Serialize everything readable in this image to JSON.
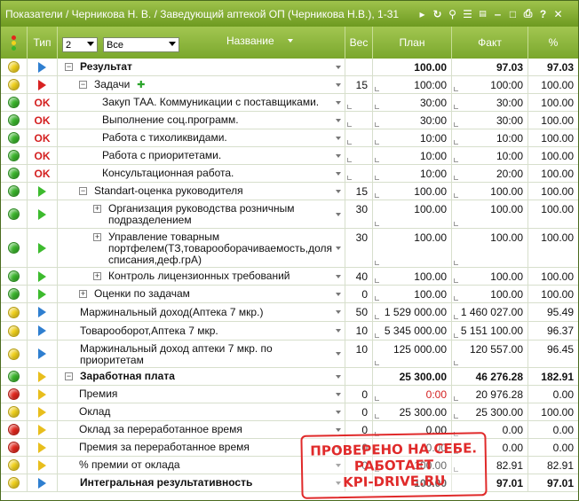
{
  "window": {
    "title": "Показатели / Черникова Н. В. / Заведующий аптекой ОП (Черникова Н.В.), 1-31"
  },
  "header": {
    "type_label": "Тип",
    "level_value": "2",
    "filter_value": "Все",
    "name_label": "Название",
    "weight_label": "Вес",
    "plan_label": "План",
    "fact_label": "Факт",
    "pct_label": "%"
  },
  "icons": {
    "title": [
      "play-icon",
      "refresh-icon",
      "search-icon",
      "list-icon",
      "csv-icon",
      "minimize-icon",
      "maximize-icon",
      "print-icon",
      "help-icon",
      "close-icon"
    ],
    "type_colors": {
      "red": "#d82222",
      "green": "#3dbb2e",
      "yellow": "#e8be1d",
      "blue": "#2f7fd0"
    },
    "light_colors": {
      "green": "#39b52a",
      "yellow": "#f2d21b",
      "red": "#e3261c"
    }
  },
  "rows": [
    {
      "light": "yellow",
      "type": "blue",
      "indent": 0,
      "toggle": "−",
      "name": "Результат",
      "weight": "",
      "plan": "100.00",
      "fact": "97.03",
      "pct": "97.03",
      "bold": true,
      "h": 20
    },
    {
      "light": "yellow",
      "type": "red",
      "indent": 1,
      "toggle": "−",
      "name": "Задачи",
      "extra": "green-plus",
      "weight": "15",
      "plan": "100:00",
      "fact": "100:00",
      "pct": "100.00",
      "h": 20
    },
    {
      "light": "green",
      "type": "ok",
      "indent": 2,
      "name": "Закуп ТАА. Коммуникации с поставщиками.",
      "weight": "",
      "plan": "30:00",
      "fact": "30:00",
      "pct": "100.00",
      "h": 20
    },
    {
      "light": "green",
      "type": "ok",
      "indent": 2,
      "name": "Выполнение соц.программ.",
      "weight": "",
      "plan": "30:00",
      "fact": "30:00",
      "pct": "100.00",
      "h": 20
    },
    {
      "light": "green",
      "type": "ok",
      "indent": 2,
      "name": "Работа с тихоликвидами.",
      "weight": "",
      "plan": "10:00",
      "fact": "10:00",
      "pct": "100.00",
      "h": 20
    },
    {
      "light": "green",
      "type": "ok",
      "indent": 2,
      "name": "Работа с приоритетами.",
      "weight": "",
      "plan": "10:00",
      "fact": "10:00",
      "pct": "100.00",
      "h": 20
    },
    {
      "light": "green",
      "type": "ok",
      "indent": 2,
      "name": "Консультационная работа.",
      "weight": "",
      "plan": "10:00",
      "fact": "20:00",
      "pct": "100.00",
      "h": 20
    },
    {
      "light": "green",
      "type": "green",
      "indent": 1,
      "toggle": "−",
      "name": "Standart-оценка руководителя",
      "weight": "15",
      "plan": "100.00",
      "fact": "100.00",
      "pct": "100.00",
      "h": 20
    },
    {
      "light": "green",
      "type": "green",
      "indent": 2,
      "toggle": "+",
      "name": "Организация руководства розничным подразделением",
      "weight": "30",
      "plan": "100.00",
      "fact": "100.00",
      "pct": "100.00",
      "h": 32,
      "align": "top"
    },
    {
      "light": "green",
      "type": "green",
      "indent": 2,
      "toggle": "+",
      "name": "Управление товарным портфелем(ТЗ,товарооборачиваемость,доля списания,деф.грА)",
      "weight": "30",
      "plan": "100.00",
      "fact": "100.00",
      "pct": "100.00",
      "h": 44,
      "align": "top"
    },
    {
      "light": "green",
      "type": "green",
      "indent": 2,
      "toggle": "+",
      "name": "Контроль лицензионных требований",
      "weight": "40",
      "plan": "100.00",
      "fact": "100.00",
      "pct": "100.00",
      "h": 20
    },
    {
      "light": "green",
      "type": "green",
      "indent": 1,
      "toggle": "+",
      "name": "Оценки по задачам",
      "weight": "0",
      "plan": "100.00",
      "fact": "100.00",
      "pct": "100.00",
      "h": 20
    },
    {
      "light": "yellow",
      "type": "blue",
      "indent": 0,
      "name": "Маржинальный доход(Аптека 7 мкр.)",
      "weight": "50",
      "plan": "1 529 000.00",
      "fact": "1 460 027.00",
      "pct": "95.49",
      "h": 21
    },
    {
      "light": "yellow",
      "type": "blue",
      "indent": 0,
      "name": "Товарооборот,Аптека 7 мкр.",
      "weight": "10",
      "plan": "5 345 000.00",
      "fact": "5 151 100.00",
      "pct": "96.37",
      "h": 21
    },
    {
      "light": "yellow",
      "type": "blue",
      "indent": 0,
      "name": "Маржинальный доход аптеки 7 мкр. по приоритетам",
      "weight": "10",
      "plan": "125 000.00",
      "fact": "120 557.00",
      "pct": "96.45",
      "h": 31,
      "align": "top"
    },
    {
      "light": "green",
      "type": "yellow",
      "indent": 0,
      "toggle": "−",
      "name": "Заработная плата",
      "weight": "",
      "plan": "25 300.00",
      "fact": "46 276.28",
      "pct": "182.91",
      "bold": true,
      "h": 20
    },
    {
      "light": "red",
      "type": "yellow",
      "indent": 1,
      "name": "Премия",
      "weight": "0",
      "plan": "0:00",
      "plan_red": true,
      "fact": "20 976.28",
      "pct": "0.00",
      "h": 20
    },
    {
      "light": "yellow",
      "type": "yellow",
      "indent": 1,
      "name": "Оклад",
      "weight": "0",
      "plan": "25 300.00",
      "fact": "25 300.00",
      "pct": "100.00",
      "h": 20
    },
    {
      "light": "red",
      "type": "yellow",
      "indent": 1,
      "name": "Оклад за переработанное время",
      "weight": "0",
      "plan": "0.00",
      "fact": "0.00",
      "pct": "0.00",
      "h": 20
    },
    {
      "light": "red",
      "type": "yellow",
      "indent": 1,
      "name": "Премия за переработанное время",
      "weight": "0",
      "plan": "0.00",
      "fact": "0.00",
      "pct": "0.00",
      "h": 20
    },
    {
      "light": "yellow",
      "type": "yellow",
      "indent": 1,
      "name": "% премии от оклада",
      "weight": "0",
      "plan": "100.00",
      "fact": "82.91",
      "pct": "82.91",
      "h": 20
    },
    {
      "light": "yellow",
      "type": "blue",
      "indent": 0,
      "name": "Интегральная результативность",
      "weight": "",
      "plan": "100.00",
      "fact": "97.01",
      "pct": "97.01",
      "bold": true,
      "h": 20
    }
  ],
  "stamp": {
    "line1": "ПРОВЕРЕНО НА СЕБЕ.",
    "line2": "РАБОТАЕТ",
    "line3": "KPI-DRIVE.RU"
  }
}
